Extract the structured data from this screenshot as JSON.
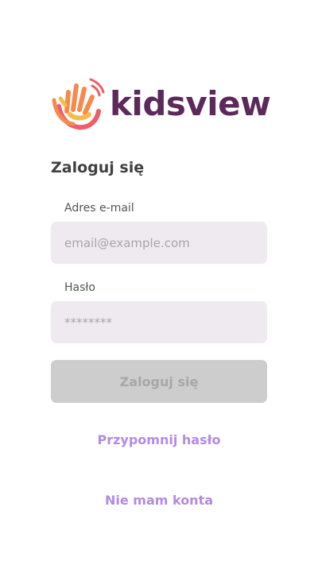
{
  "brand": {
    "name": "kidsview",
    "logo_icon": "waving-hand-icon",
    "colors": {
      "text": "#5c2a5a",
      "hand_orange": "#f58a4c",
      "hand_pink": "#ee5d6c",
      "hand_yellow": "#f8bb4a"
    }
  },
  "login": {
    "title": "Zaloguj się",
    "email": {
      "label": "Adres e-mail",
      "placeholder": "email@example.com",
      "value": ""
    },
    "password": {
      "label": "Hasło",
      "placeholder": "********",
      "value": ""
    },
    "submit_label": "Zaloguj się",
    "submit_disabled": true
  },
  "links": {
    "forgot_password": "Przypomnij hasło",
    "register": "Nie mam konta",
    "color": "#b48ae6"
  }
}
